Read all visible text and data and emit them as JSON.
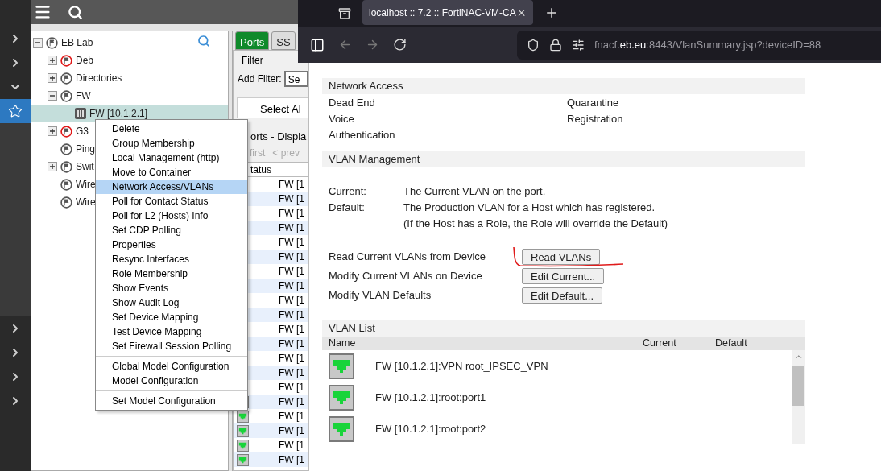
{
  "rail": {
    "items": [
      {
        "kind": "expand",
        "selected": false
      },
      {
        "kind": "expand",
        "selected": false
      },
      {
        "kind": "collapse",
        "selected": false
      },
      {
        "kind": "favorites",
        "selected": true
      },
      {
        "kind": "expand",
        "selected": false
      },
      {
        "kind": "expand",
        "selected": false
      },
      {
        "kind": "expand",
        "selected": false
      },
      {
        "kind": "expand",
        "selected": false
      }
    ]
  },
  "tree": {
    "root": {
      "label": "EB Lab",
      "kind": "container",
      "expanded": true,
      "alert": false,
      "selected": false,
      "children": [
        {
          "label": "Deb",
          "kind": "container",
          "expanded": false,
          "alert": true,
          "selected": false
        },
        {
          "label": "Directories",
          "kind": "container",
          "expanded": false,
          "alert": false,
          "selected": false
        },
        {
          "label": "FW",
          "kind": "container",
          "expanded": true,
          "alert": false,
          "selected": false,
          "children": [
            {
              "label": "FW [10.1.2.1]",
              "kind": "device",
              "selected": true
            }
          ]
        },
        {
          "label": "G3",
          "kind": "container",
          "expanded": false,
          "alert": true,
          "selected": false
        },
        {
          "label": "Ping",
          "kind": "container",
          "alert": false,
          "selected": false
        },
        {
          "label": "Swit",
          "kind": "container",
          "expanded": false,
          "alert": false,
          "selected": false
        },
        {
          "label": "Wire",
          "kind": "container",
          "alert": false,
          "selected": false
        },
        {
          "label": "Wire",
          "kind": "container",
          "alert": false,
          "selected": false
        }
      ]
    }
  },
  "ports_panel": {
    "tabs": [
      {
        "label": "Ports",
        "selected": true
      },
      {
        "label": "SS",
        "selected": false
      }
    ],
    "filter_title": "Filter",
    "add_filter_label": "Add Filter:",
    "add_filter_value": "Se",
    "select_all_button": "Select Al",
    "list_title": "orts - Displa",
    "pager": [
      "first",
      "< prev"
    ],
    "status_header": "tatus",
    "rows": [
      {
        "cell": "FW [1",
        "port_icon": false
      },
      {
        "cell": "FW [1",
        "port_icon": false
      },
      {
        "cell": "FW [1",
        "port_icon": false
      },
      {
        "cell": "FW [1",
        "port_icon": false
      },
      {
        "cell": "FW [1",
        "port_icon": false
      },
      {
        "cell": "FW [1",
        "port_icon": false
      },
      {
        "cell": "FW [1",
        "port_icon": false
      },
      {
        "cell": "FW [1",
        "port_icon": false
      },
      {
        "cell": "FW [1",
        "port_icon": false
      },
      {
        "cell": "FW [1",
        "port_icon": false
      },
      {
        "cell": "FW [1",
        "port_icon": false
      },
      {
        "cell": "FW [1",
        "port_icon": false
      },
      {
        "cell": "FW [1",
        "port_icon": false
      },
      {
        "cell": "FW [1",
        "port_icon": false
      },
      {
        "cell": "FW [1",
        "port_icon": false
      },
      {
        "cell": "FW [1",
        "port_icon": true
      },
      {
        "cell": "FW [1",
        "port_icon": true
      },
      {
        "cell": "FW [1",
        "port_icon": true
      },
      {
        "cell": "FW [1",
        "port_icon": true
      },
      {
        "cell": "FW [1",
        "port_icon": true
      }
    ]
  },
  "context_menu": {
    "groups": [
      [
        {
          "label": "Delete",
          "selected": false
        },
        {
          "label": "Group Membership",
          "selected": false
        },
        {
          "label": "Local Management (http)",
          "selected": false
        },
        {
          "label": "Move to Container",
          "selected": false
        },
        {
          "label": "Network Access/VLANs",
          "selected": true
        },
        {
          "label": "Poll for Contact Status",
          "selected": false
        },
        {
          "label": "Poll for L2 (Hosts) Info",
          "selected": false
        },
        {
          "label": "Set CDP Polling",
          "selected": false
        },
        {
          "label": "Properties",
          "selected": false
        },
        {
          "label": "Resync Interfaces",
          "selected": false
        },
        {
          "label": "Role Membership",
          "selected": false
        },
        {
          "label": "Show Events",
          "selected": false
        },
        {
          "label": "Show Audit Log",
          "selected": false
        },
        {
          "label": "Set Device Mapping",
          "selected": false
        },
        {
          "label": "Test Device Mapping",
          "selected": false
        },
        {
          "label": "Set Firewall Session Polling",
          "selected": false
        }
      ],
      [
        {
          "label": "Global Model Configuration",
          "selected": false
        },
        {
          "label": "Model Configuration",
          "selected": false
        }
      ],
      [
        {
          "label": "Set Model Configuration",
          "selected": false
        }
      ]
    ]
  },
  "browser": {
    "tab_title": "localhost :: 7.2 :: FortiNAC-VM-CA",
    "url": {
      "prefix": "fnacf.",
      "domain": "eb.eu",
      "suffix": ":8443/VlanSummary.jsp?deviceID=88"
    }
  },
  "page": {
    "network_access": {
      "title": "Network Access",
      "items": [
        [
          "Dead End",
          "Quarantine"
        ],
        [
          "Voice",
          "Registration"
        ],
        [
          "Authentication"
        ]
      ]
    },
    "vlan_management": {
      "title": "VLAN Management",
      "definitions": [
        {
          "term": "Current:",
          "text": "The Current VLAN on the port."
        },
        {
          "term": "Default:",
          "text": "The Production VLAN for a Host which has registered."
        },
        {
          "text": "(If the Host has a Role, the Role will override the Default)"
        }
      ],
      "actions": [
        {
          "label": "Read Current VLANs from Device",
          "button": "Read VLANs",
          "annotated": true
        },
        {
          "label": "Modify Current VLANs on Device",
          "button": "Edit Current...",
          "annotated": false
        },
        {
          "label": "Modify VLAN Defaults",
          "button": "Edit Default...",
          "annotated": false
        }
      ]
    },
    "vlan_list": {
      "title": "VLAN List",
      "columns": [
        "Name",
        "Current",
        "Default"
      ],
      "rows": [
        {
          "name": "FW [10.1.2.1]:VPN root_IPSEC_VPN"
        },
        {
          "name": "FW [10.1.2.1]:root:port1"
        },
        {
          "name": "FW [10.1.2.1]:root:port2"
        }
      ]
    }
  }
}
